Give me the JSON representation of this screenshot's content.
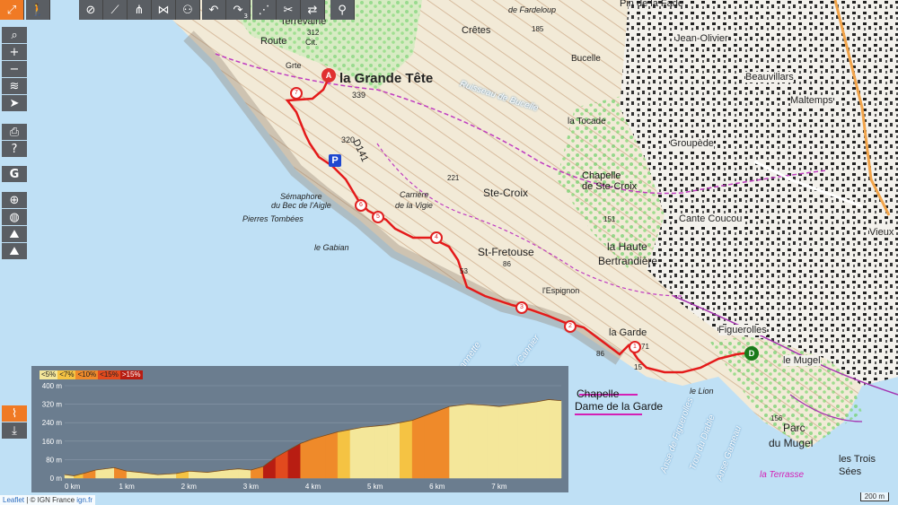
{
  "toolbar": {
    "icons": [
      "expand-icon",
      "walker-icon",
      "hide-icon",
      "route-line-icon",
      "route-tree-icon",
      "route-cross-icon",
      "bike-icon",
      "undo-icon",
      "redo-icon",
      "edit-node-icon",
      "split-icon",
      "swap-icon",
      "pin-icon"
    ],
    "redo_count": "3"
  },
  "sidebar": {
    "group1": [
      "search-icon",
      "zoom-in-icon",
      "zoom-out-icon",
      "layers-icon",
      "locate-icon"
    ],
    "group2": [
      "print-icon",
      "help-icon"
    ],
    "group3": [
      "google-icon"
    ],
    "group4": [
      "crosshair-icon",
      "globe-icon",
      "hiker-icon",
      "hiker-alt-icon"
    ],
    "bottom": [
      "chart-icon",
      "download-icon"
    ]
  },
  "map": {
    "labels": {
      "grande_tete": "la Grande Tête",
      "route": "Route",
      "terrevaine": "Terrevaine",
      "cit": "Cit.",
      "grte": "Grte",
      "alt_339": "339",
      "alt_312": "312",
      "alt_320": "320",
      "d141": "D141",
      "d141b": "D141b",
      "semaphore": "Sémaphore",
      "bec_aigle": "du Bec de l'Aigle",
      "pierres": "Pierres Tombées",
      "gabian": "le Gabian",
      "carriere": "Carrière",
      "vigie": "de la Vigie",
      "ste_croix": "Ste-Croix",
      "st_fretouse": "St-Fretouse",
      "espignon": "l'Espignon",
      "la_garde": "la Garde",
      "alt_86": "86",
      "alt_53": "53",
      "alt_15": "15",
      "alt_71": "71",
      "lion": "le Lion",
      "haute_bertrandiere": "la Haute",
      "bertrandiere": "Bertrandière",
      "tocade": "la Tocade",
      "bucelle": "Bucelle",
      "cretes": "Crêtes",
      "fardeloup": "de Fardeloup",
      "pin_fade": "Pin de la Fade",
      "jean_olivier": "Jean-Olivier",
      "beauvillars": "Beauvillars",
      "maltemps": "Maltemps",
      "groupede": "Groupède",
      "chapelle_ste_croix_1": "Chapelle",
      "chapelle_ste_croix_2": "de Ste-Croix",
      "cante_coucou": "Cante Coucou",
      "vieux": "Vieux",
      "figuerolles": "Figuerolles",
      "mugel": "le Mugel",
      "parc_mugel": "du Mugel",
      "parc": "Parc",
      "trois_sees": "les Trois",
      "sees": "Sées",
      "terrasse": "la Terrasse",
      "ruisseau": "Ruisseau de Bucelle",
      "trou_jeannette": "Trou de Jeannette",
      "anse_cannier": "Anse du Cannier",
      "trou_diable": "Trou du Diable",
      "anse_figuerolles": "Anse de Figuerolles",
      "anse_gameau": "Anse Gameau",
      "alt_185": "185",
      "alt_151": "151",
      "alt_221": "221",
      "alt_156": "156",
      "alt_86b": "86"
    },
    "start_marker": "A",
    "end_marker": "D",
    "waypoints": [
      "1",
      "2",
      "3",
      "4",
      "5",
      "6",
      "7"
    ],
    "parking": "P",
    "chapelle_garde_1": "Chapelle",
    "chapelle_garde_2": "Dame de la Garde",
    "scale": "200 m"
  },
  "profile": {
    "legend": [
      "<5%",
      "<7%",
      "<10%",
      "<15%",
      ">15%"
    ],
    "legend_colors": [
      "#f4e79a",
      "#f5c343",
      "#ef8a2a",
      "#e24a1e",
      "#b81d12"
    ],
    "y_labels": [
      "400 m",
      "320 m",
      "240 m",
      "160 m",
      "80 m",
      "0 m"
    ],
    "x_labels": [
      "0 km",
      "1 km",
      "2 km",
      "3 km",
      "4 km",
      "5 km",
      "6 km",
      "7 km"
    ]
  },
  "chart_data": {
    "type": "area",
    "title": "",
    "xlabel": "",
    "ylabel": "",
    "xlim": [
      0,
      8
    ],
    "ylim": [
      0,
      400
    ],
    "x": [
      0,
      0.15,
      0.3,
      0.5,
      0.8,
      1.0,
      1.2,
      1.5,
      1.8,
      2.0,
      2.3,
      2.6,
      2.8,
      3.0,
      3.2,
      3.4,
      3.6,
      3.8,
      4.0,
      4.2,
      4.4,
      4.6,
      4.8,
      5.0,
      5.2,
      5.4,
      5.6,
      5.8,
      6.0,
      6.2,
      6.5,
      6.8,
      7.0,
      7.3,
      7.6,
      7.8,
      8.0
    ],
    "y": [
      15,
      10,
      20,
      35,
      45,
      30,
      25,
      15,
      20,
      30,
      25,
      35,
      40,
      35,
      50,
      90,
      120,
      150,
      170,
      185,
      200,
      210,
      220,
      225,
      230,
      240,
      250,
      270,
      290,
      310,
      320,
      315,
      310,
      320,
      330,
      340,
      335
    ],
    "grade_colors": [
      "#f4e79a",
      "#f5c343",
      "#ef8a2a",
      "#e24a1e",
      "#b81d12"
    ]
  }
}
